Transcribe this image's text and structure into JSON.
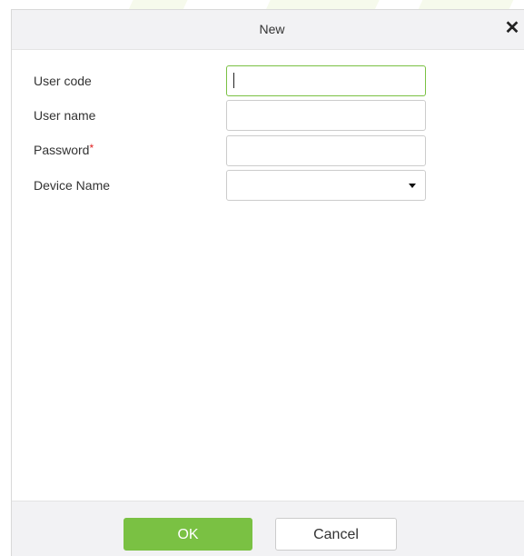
{
  "dialog": {
    "title": "New",
    "close_glyph": "✕"
  },
  "form": {
    "user_code": {
      "label": "User code",
      "value": "",
      "placeholder": ""
    },
    "user_name": {
      "label": "User name",
      "value": "",
      "placeholder": ""
    },
    "password": {
      "label": "Password",
      "required_mark": "*",
      "value": "",
      "placeholder": ""
    },
    "device_name": {
      "label": "Device Name",
      "selected": ""
    }
  },
  "footer": {
    "ok_label": "OK",
    "cancel_label": "Cancel"
  },
  "colors": {
    "accent": "#7ac143",
    "required": "#e02020",
    "header_bg": "#f2f2f4"
  },
  "icons": {
    "close": "close-icon",
    "dropdown": "chevron-down-icon"
  }
}
